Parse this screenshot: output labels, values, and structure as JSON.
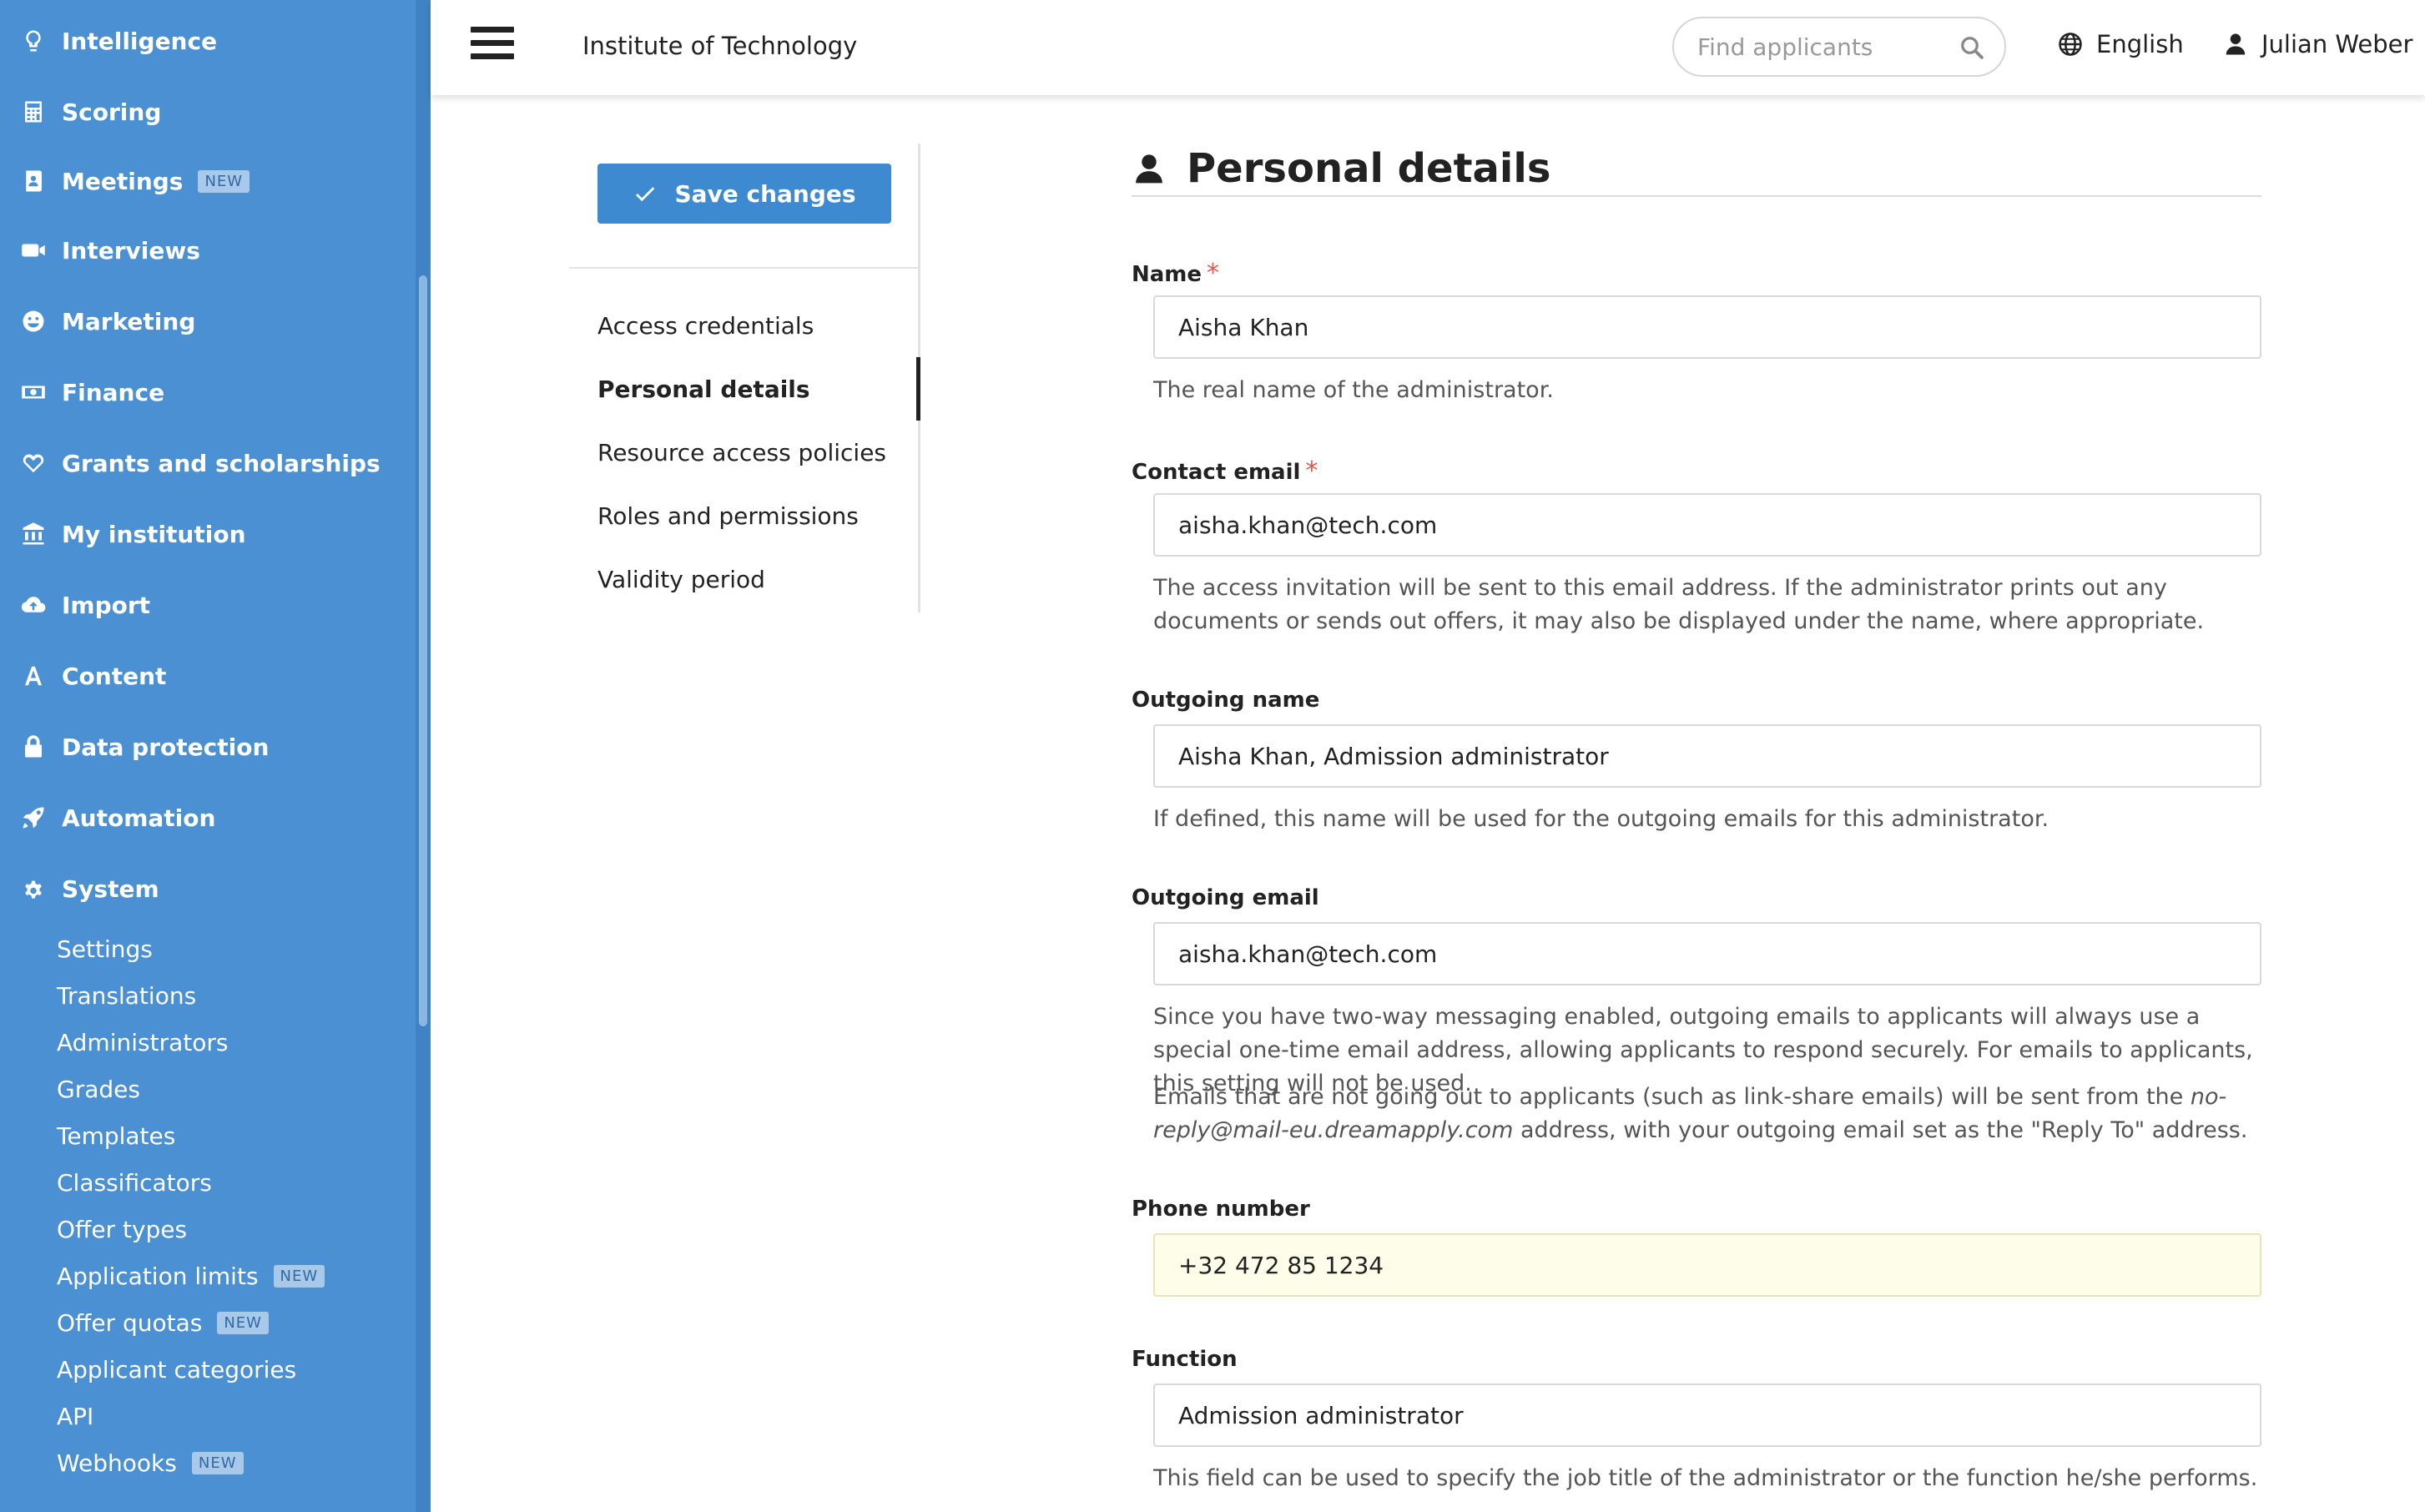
{
  "sidebar": {
    "items": [
      {
        "label": "Intelligence",
        "icon": "lightbulb-icon"
      },
      {
        "label": "Scoring",
        "icon": "calculator-icon"
      },
      {
        "label": "Meetings",
        "icon": "address-book-icon",
        "badge": "NEW"
      },
      {
        "label": "Interviews",
        "icon": "video-camera-icon"
      },
      {
        "label": "Marketing",
        "icon": "smiley-icon"
      },
      {
        "label": "Finance",
        "icon": "money-bill-icon"
      },
      {
        "label": "Grants and scholarships",
        "icon": "heart-icon"
      },
      {
        "label": "My institution",
        "icon": "bank-icon"
      },
      {
        "label": "Import",
        "icon": "cloud-upload-icon"
      },
      {
        "label": "Content",
        "icon": "font-icon"
      },
      {
        "label": "Data protection",
        "icon": "lock-icon"
      },
      {
        "label": "Automation",
        "icon": "rocket-icon"
      },
      {
        "label": "System",
        "icon": "gear-icon"
      }
    ],
    "sub_items": [
      {
        "label": "Settings"
      },
      {
        "label": "Translations"
      },
      {
        "label": "Administrators"
      },
      {
        "label": "Grades"
      },
      {
        "label": "Templates"
      },
      {
        "label": "Classificators"
      },
      {
        "label": "Offer types"
      },
      {
        "label": "Application limits",
        "badge": "NEW"
      },
      {
        "label": "Offer quotas",
        "badge": "NEW"
      },
      {
        "label": "Applicant categories"
      },
      {
        "label": "API"
      },
      {
        "label": "Webhooks",
        "badge": "NEW"
      }
    ],
    "accent_color": "#4a90d2"
  },
  "header": {
    "org_name": "Institute of Technology",
    "search_placeholder": "Find applicants",
    "language": "English",
    "user_name": "Julian Weber"
  },
  "settings_nav": {
    "save_label": "Save changes",
    "links": [
      "Access credentials",
      "Personal details",
      "Resource access policies",
      "Roles and permissions",
      "Validity period"
    ],
    "active": "Personal details"
  },
  "form": {
    "title": "Personal details",
    "name": {
      "label": "Name",
      "required_mark": "*",
      "value": "Aisha Khan",
      "help": "The real name of the administrator."
    },
    "contact_email": {
      "label": "Contact email",
      "required_mark": "*",
      "value": "aisha.khan@tech.com",
      "help": "The access invitation will be sent to this email address. If the administrator prints out any documents or sends out offers, it may also be displayed under the name, where appropriate."
    },
    "outgoing_name": {
      "label": "Outgoing name",
      "value": "Aisha Khan, Admission administrator",
      "help": "If defined, this name will be used for the outgoing emails for this administrator."
    },
    "outgoing_email": {
      "label": "Outgoing email",
      "value": "aisha.khan@tech.com",
      "help": "Since you have two-way messaging enabled, outgoing emails to applicants will always use a special one-time email address, allowing applicants to respond securely. For emails to applicants, this setting will not be used.",
      "help2_before": "Emails that are not going out to applicants (such as link-share emails) will be sent from the ",
      "help2_address": "no-reply@mail-eu.dreamapply.com",
      "help2_after": " address, with your outgoing email set as the \"Reply To\" address."
    },
    "phone": {
      "label": "Phone number",
      "value": "+32 472 85 1234"
    },
    "function": {
      "label": "Function",
      "value": "Admission administrator",
      "help": "This field can be used to specify the job title of the administrator or the function he/she performs."
    }
  }
}
